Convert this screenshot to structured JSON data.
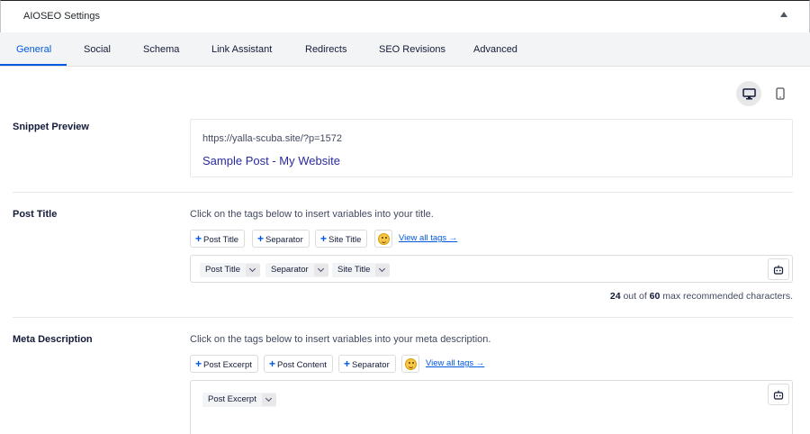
{
  "header": {
    "title": "AIOSEO Settings"
  },
  "tabs": [
    {
      "label": "General"
    },
    {
      "label": "Social"
    },
    {
      "label": "Schema"
    },
    {
      "label": "Link Assistant"
    },
    {
      "label": "Redirects"
    },
    {
      "label": "SEO Revisions"
    },
    {
      "label": "Advanced"
    }
  ],
  "device_toggle": {
    "desktop_icon": "desktop-icon",
    "mobile_icon": "mobile-icon"
  },
  "snippet": {
    "label": "Snippet Preview",
    "url": "https://yalla-scuba.site/?p=1572",
    "title": "Sample Post - My Website"
  },
  "post_title": {
    "label": "Post Title",
    "help": "Click on the tags below to insert variables into your title.",
    "tags": [
      "Post Title",
      "Separator",
      "Site Title"
    ],
    "view_all": "View all tags →",
    "chips": [
      "Post Title",
      "Separator",
      "Site Title"
    ],
    "count_current": "24",
    "count_mid": " out of ",
    "count_max": "60",
    "count_suffix": " max recommended characters."
  },
  "meta_description": {
    "label": "Meta Description",
    "help": "Click on the tags below to insert variables into your meta description.",
    "tags": [
      "Post Excerpt",
      "Post Content",
      "Separator"
    ],
    "view_all": "View all tags →",
    "chips": [
      "Post Excerpt"
    ]
  },
  "colors": {
    "accent": "#005ae0",
    "link_title": "#2a2aa0",
    "text": "#141b38"
  }
}
